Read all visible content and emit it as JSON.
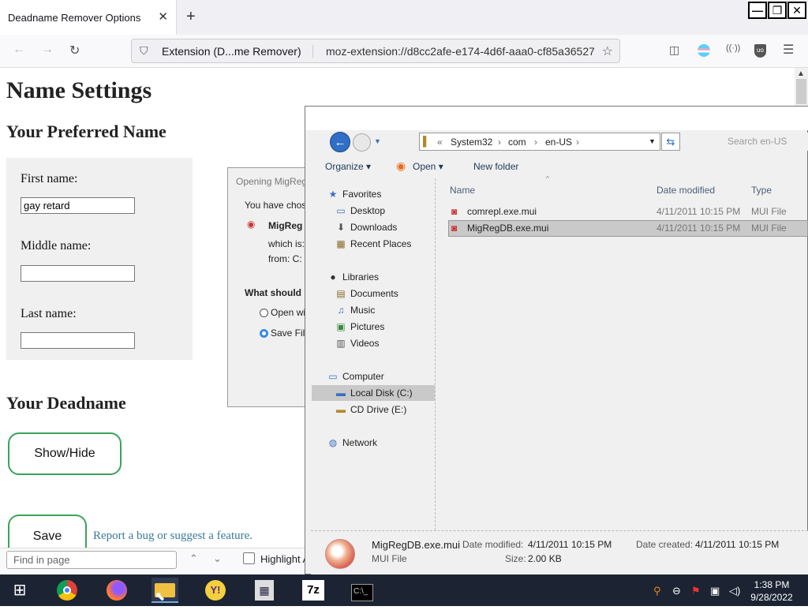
{
  "browser": {
    "tab_title": "Deadname Remover Options",
    "tab_close": "✕",
    "new_tab": "+",
    "url_identity": "Extension (D...me Remover)",
    "url": "moz-extension://d8cc2afe-e174-4d6f-aaa0-cf85a36527",
    "window_buttons": [
      "—",
      "❐",
      "✕"
    ]
  },
  "page": {
    "title": "Name Settings",
    "preferred_heading": "Your Preferred Name",
    "first_label": "First name:",
    "first_value": "gay retard",
    "middle_label": "Middle name:",
    "middle_value": "",
    "last_label": "Last name:",
    "last_value": "",
    "deadname_heading": "Your Deadname",
    "show_hide": "Show/Hide",
    "save": "Save",
    "bug_link": "Report a bug or suggest a feature."
  },
  "open_dialog": {
    "title": "Opening MigReg",
    "line1": "You have chos",
    "filename": "MigReg",
    "which_is": "which is:",
    "from": "from:  C:",
    "question": "What should F",
    "opt_open": "Open wi",
    "opt_save": "Save File"
  },
  "findbar": {
    "placeholder": "Find in page",
    "highlight": "Highlight A"
  },
  "explorer": {
    "breadcrumb": [
      "«",
      "System32",
      "›",
      "com",
      "›",
      "en-US",
      "›"
    ],
    "search_placeholder": "Search en-US",
    "toolbar": {
      "organize": "Organize ▾",
      "open": "Open ▾",
      "new_folder": "New folder"
    },
    "nav": {
      "favorites": "Favorites",
      "desktop": "Desktop",
      "downloads": "Downloads",
      "recent": "Recent Places",
      "libraries": "Libraries",
      "documents": "Documents",
      "music": "Music",
      "pictures": "Pictures",
      "videos": "Videos",
      "computer": "Computer",
      "local_disk": "Local Disk (C:)",
      "cd_drive": "CD Drive (E:)",
      "network": "Network"
    },
    "columns": {
      "name": "Name",
      "date": "Date modified",
      "type": "Type"
    },
    "files": [
      {
        "name": "comrepl.exe.mui",
        "date": "4/11/2011 10:15 PM",
        "type": "MUI File"
      },
      {
        "name": "MigRegDB.exe.mui",
        "date": "4/11/2011 10:15 PM",
        "type": "MUI File"
      }
    ],
    "details": {
      "name": "MigRegDB.exe.mui",
      "kind": "MUI File",
      "modified_label": "Date modified:",
      "modified": "4/11/2011 10:15 PM",
      "created_label": "Date created:",
      "created": "4/11/2011 10:15 PM",
      "size_label": "Size:",
      "size": "2.00 KB"
    }
  },
  "taskbar": {
    "time": "1:38 PM",
    "date": "9/28/2022"
  }
}
